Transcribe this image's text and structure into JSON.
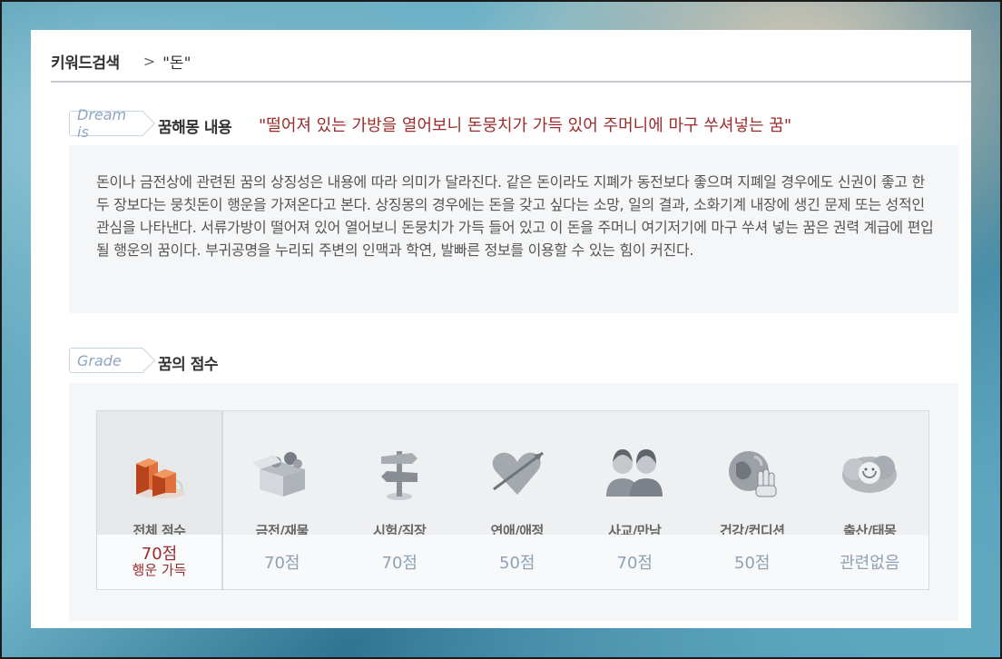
{
  "breadcrumb": {
    "title": "키워드검색",
    "separator": ">",
    "keyword": "\"돈\""
  },
  "dream": {
    "tag": "Dream is",
    "label": "꿈해몽 내용",
    "quote": "\"떨어져 있는 가방을 열어보니 돈뭉치가 가득 있어 주머니에 마구 쑤셔넣는 꿈\"",
    "description": "돈이나 금전상에 관련된 꿈의 상징성은 내용에 따라 의미가 달라진다. 같은 돈이라도 지폐가 동전보다 좋으며 지폐일 경우에도 신권이 좋고 한두 장보다는 뭉칫돈이 행운을 가져온다고 본다. 상징몽의 경우에는 돈을 갖고 싶다는 소망, 일의 결과, 소화기계 내장에 생긴 문제 또는 성적인 관심을 나타낸다. 서류가방이 떨어져 있어 열어보니 돈뭉치가 가득 들어 있고 이 돈을 주머니 여기저기에 마구 쑤셔 넣는 꿈은 권력 계급에 편입될 행운의 꿈이다. 부귀공명을 누리되 주변의 인맥과 학연, 발빠른 정보를 이용할 수 있는 힘이 커진다."
  },
  "grade": {
    "tag": "Grade",
    "label": "꿈의 점수",
    "total": {
      "name": "전체 점수",
      "score": "70점",
      "luck": "행운 가득",
      "icon": "bar-chart-icon",
      "color": "#c8542a"
    },
    "categories": [
      {
        "name": "금전/재물",
        "score": "70점",
        "icon": "treasure-box-icon"
      },
      {
        "name": "시험/직장",
        "score": "70점",
        "icon": "signpost-icon"
      },
      {
        "name": "연애/애정",
        "score": "50점",
        "icon": "heart-arrow-icon"
      },
      {
        "name": "사교/만남",
        "score": "70점",
        "icon": "people-icon"
      },
      {
        "name": "건강/컨디션",
        "score": "50점",
        "icon": "globe-hand-icon"
      },
      {
        "name": "출산/태몽",
        "score": "관련없음",
        "icon": "baby-cloud-icon"
      }
    ]
  }
}
